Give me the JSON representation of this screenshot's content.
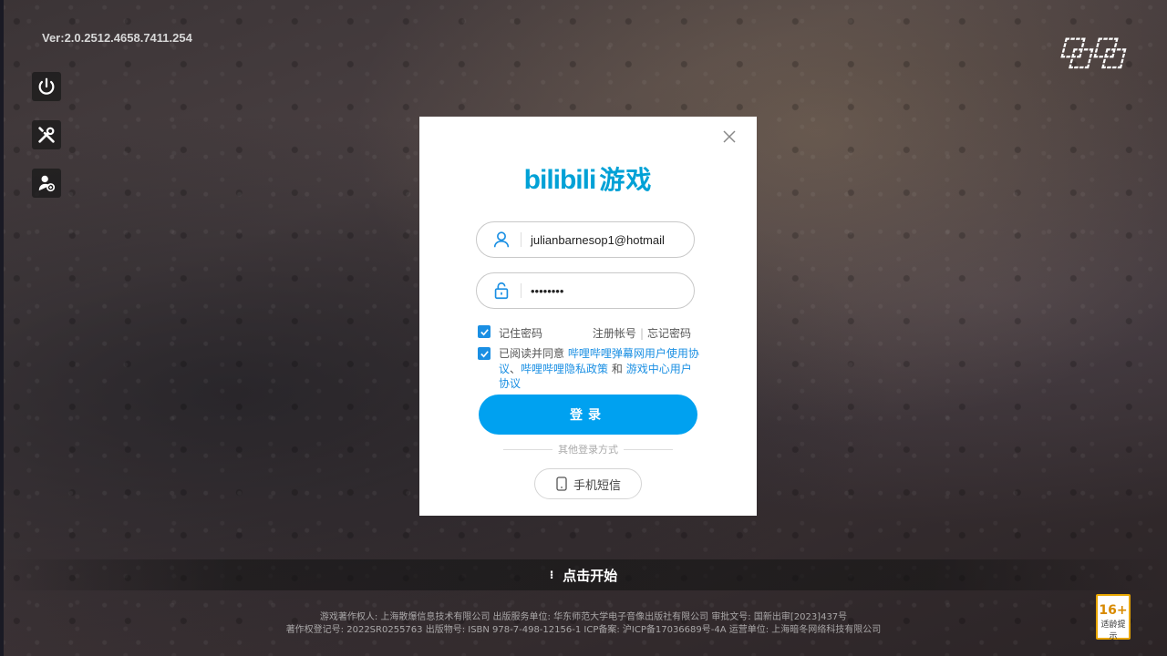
{
  "version": "Ver:2.0.2512.4658.7411.254",
  "game_logo_text": "ONL",
  "side_buttons": [
    {
      "name": "power-icon"
    },
    {
      "name": "tools-icon"
    },
    {
      "name": "user-switch-icon"
    }
  ],
  "dialog": {
    "brand_main": "bilibili",
    "brand_sub": "游戏",
    "username": "julianbarnesop1@hotmail",
    "password": "••••••••",
    "remember_label": "记住密码",
    "register_label": "注册帐号",
    "forgot_label": "忘记密码",
    "agree_prefix": "已阅读并同意",
    "agree_link1": "哔哩哔哩弹幕网用户使用协议",
    "agree_sep": "、",
    "agree_link2": "哔哩哔哩隐私政策",
    "agree_and": "和",
    "agree_link3": "游戏中心用户协议",
    "login_label": "登录",
    "other_methods": "其他登录方式",
    "sms_label": "手机短信"
  },
  "start_label": "点击开始",
  "footer": {
    "line1": "游戏著作权人: 上海散爆信息技术有限公司  出版服务单位: 华东师范大学电子音像出版社有限公司  审批文号: 国新出审[2023]437号",
    "line2": "著作权登记号: 2022SR0255763 出版物号: ISBN 978-7-498-12156-1 ICP备案: 沪ICP备17036689号-4A 运营单位: 上海暗冬网络科技有限公司"
  },
  "age_rating": {
    "age": "16+",
    "label": "适龄提示"
  }
}
